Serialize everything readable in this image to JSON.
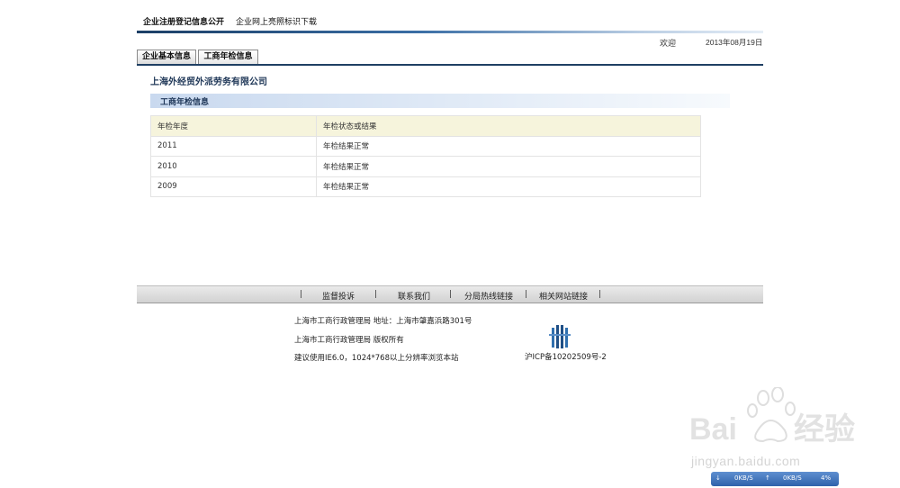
{
  "top_nav": {
    "item1": "企业注册登记信息公开",
    "item2": "企业网上亮照标识下载"
  },
  "header": {
    "welcome": "欢迎",
    "date": "2013年08月19日"
  },
  "tabs": [
    {
      "label": "企业基本信息"
    },
    {
      "label": "工商年检信息"
    }
  ],
  "company_name": "上海外经贸外派劳务有限公司",
  "section_title": "工商年检信息",
  "table": {
    "headers": [
      "年检年度",
      "年检状态或结果"
    ],
    "rows": [
      [
        "2011",
        "年检结果正常"
      ],
      [
        "2010",
        "年检结果正常"
      ],
      [
        "2009",
        "年检结果正常"
      ]
    ]
  },
  "footer": {
    "separator": "|",
    "links": [
      "监督投诉",
      "联系我们",
      "分局热线链接",
      "相关网站链接"
    ],
    "address": "上海市工商行政管理局  地址：上海市肇嘉浜路301号",
    "copyright": "上海市工商行政管理局  版权所有",
    "browser_note": "建议使用IE6.0，1024*768以上分辨率浏览本站",
    "icp": "沪ICP备10202509号-2"
  },
  "watermark": {
    "url": "jingyan.baidu.com"
  },
  "netmeter": {
    "down": "0KB/S",
    "up": "0KB/S",
    "percent": "4%"
  },
  "colors": {
    "accent_dark": "#1f3f63",
    "section_bg": "#c9d9ef",
    "table_head_bg": "#f6f4dc"
  }
}
